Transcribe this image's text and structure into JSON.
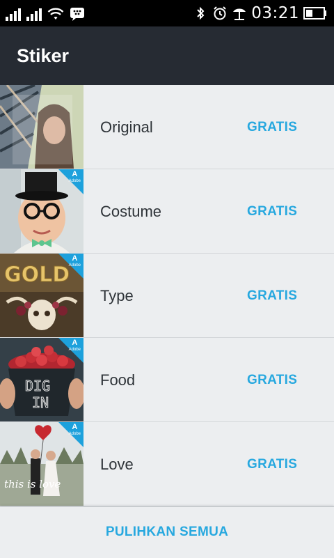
{
  "status_bar": {
    "time": "03:21",
    "icons": [
      "signal-icon",
      "signal-icon",
      "wifi-icon",
      "bbm-icon",
      "bluetooth-icon",
      "alarm-icon",
      "beach-icon",
      "battery-icon"
    ]
  },
  "app_bar": {
    "title": "Stiker"
  },
  "list": {
    "items": [
      {
        "name": "Original",
        "price": "GRATIS",
        "adobe_badge": false
      },
      {
        "name": "Costume",
        "price": "GRATIS",
        "adobe_badge": true
      },
      {
        "name": "Type",
        "price": "GRATIS",
        "adobe_badge": true
      },
      {
        "name": "Food",
        "price": "GRATIS",
        "adobe_badge": true
      },
      {
        "name": "Love",
        "price": "GRATIS",
        "adobe_badge": true
      }
    ]
  },
  "thumbnails": {
    "type_text": "GOLD",
    "food_text_1": "DIG",
    "food_text_2": "IN",
    "love_text": "this is love",
    "badge_text": "A",
    "badge_sub": "Adobe"
  },
  "bottom": {
    "restore_label": "PULIHKAN SEMUA"
  },
  "colors": {
    "accent": "#27a8df",
    "appbar": "#262b33",
    "background": "#eceef0",
    "badge": "#1da1dc"
  }
}
